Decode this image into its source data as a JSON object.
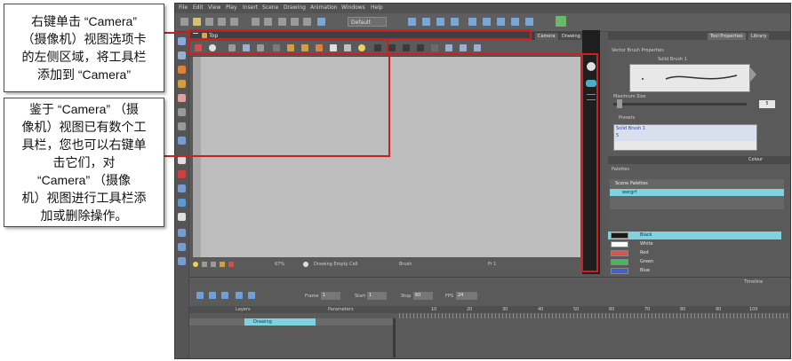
{
  "menu": [
    "File",
    "Edit",
    "View",
    "Play",
    "Insert",
    "Scene",
    "Drawing",
    "Animation",
    "Windows",
    "Help"
  ],
  "toolbar": {
    "drawing_mode": "Default"
  },
  "camera_panel": {
    "title": "Top",
    "tabs": [
      "Camera",
      "Drawing"
    ],
    "status": {
      "zoom": "67%",
      "mode": "Drawing Empty Cell",
      "tool": "Brush",
      "frame": "Fr 1"
    }
  },
  "tool_properties": {
    "tabs": [
      "Tool Properties",
      "Library"
    ],
    "preset_title": "Vector Brush Properties",
    "brush_name": "Solid Brush 1",
    "max_size_label": "Maximum Size",
    "max_size_value": "5",
    "presets_label": "Presets",
    "preset_item": "Solid Brush 1",
    "preset_size": "5"
  },
  "colour": {
    "title": "Colour",
    "palettes_label": "Palettes",
    "scene_palettes_label": "Scene Palettes",
    "palette_item": "wergrf",
    "swatches": [
      {
        "name": "Black",
        "color": "#1a1a1a"
      },
      {
        "name": "White",
        "color": "#ffffff"
      },
      {
        "name": "Red",
        "color": "#e05050"
      },
      {
        "name": "Green",
        "color": "#40c050"
      },
      {
        "name": "Blue",
        "color": "#4060d0"
      }
    ]
  },
  "timeline": {
    "title": "Timeline",
    "frame_label": "Frame",
    "frame_value": "1",
    "start_label": "Start",
    "start_value": "1",
    "stop_label": "Stop",
    "stop_value": "60",
    "fps_label": "FPS",
    "fps_value": "24",
    "layers_label": "Layers",
    "parameters_label": "Parameters",
    "layer_name": "Drawing",
    "ruler": [
      "10",
      "20",
      "30",
      "40",
      "50",
      "60",
      "70",
      "80",
      "90",
      "100"
    ]
  },
  "callouts": {
    "top": [
      "右键单击 “Camera”",
      "（摄像机）视图选项卡",
      "的左侧区域，将工具栏",
      "添加到 “Camera”"
    ],
    "bottom": [
      "鉴于 “Camera” （摄",
      "像机）视图已有数个工",
      "具栏，您也可以右键单",
      "击它们，对",
      "“Camera” （摄像",
      "机）视图进行工具栏添",
      "加或删除操作。"
    ]
  },
  "colors": {
    "highlight": "#cc1f1f",
    "selection": "#7fd3e0"
  }
}
